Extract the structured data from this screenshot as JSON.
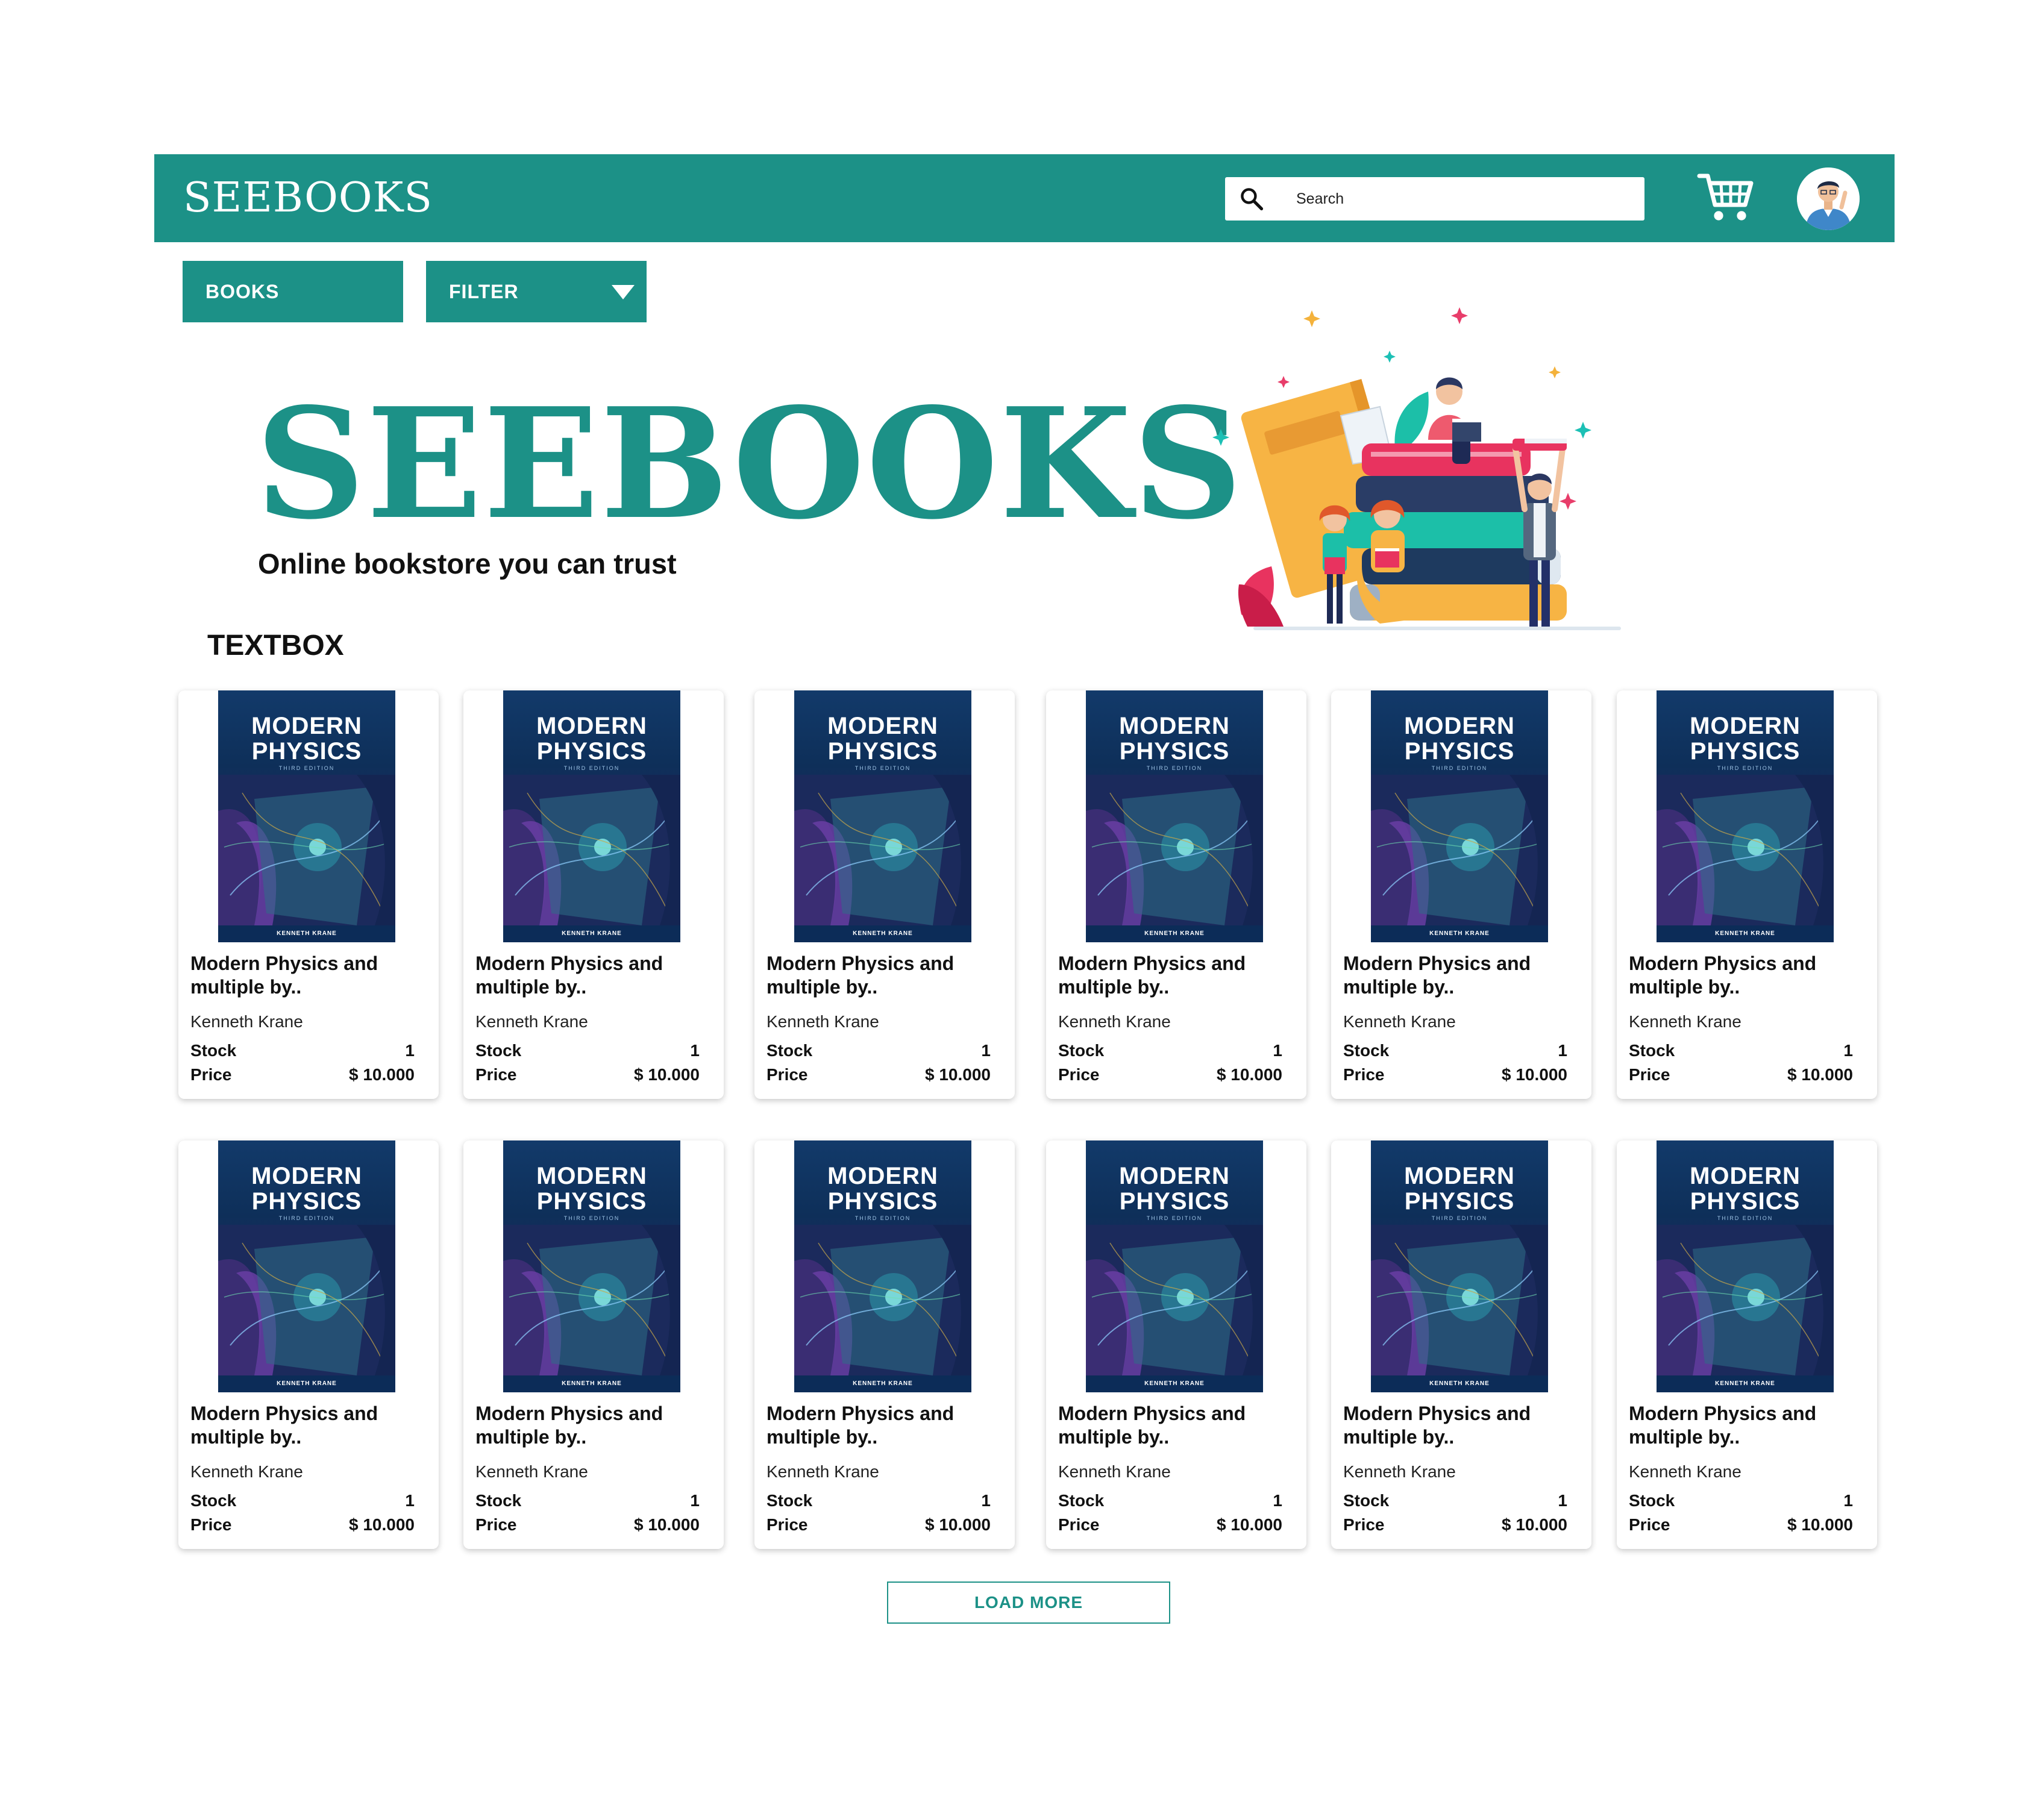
{
  "header": {
    "logo": "SEEBOOKS",
    "search_placeholder": "Search",
    "icons": [
      "search-icon",
      "cart-icon",
      "avatar"
    ]
  },
  "toolbar": {
    "books_label": "BOOKS",
    "filter_label": "FILTER"
  },
  "hero": {
    "title": "SEEBOOKS",
    "subtitle": "Online bookstore you can trust"
  },
  "section_label": "TEXTBOX",
  "book_cover": {
    "title_line1": "MODERN",
    "title_line2": "PHYSICS",
    "edition": "THIRD EDITION",
    "author": "KENNETH KRANE"
  },
  "books": [
    {
      "title": "Modern Physics and multiple by..",
      "author": "Kenneth Krane",
      "stock_label": "Stock",
      "stock": "1",
      "price_label": "Price",
      "price": "$ 10.000"
    },
    {
      "title": "Modern Physics and multiple by..",
      "author": "Kenneth Krane",
      "stock_label": "Stock",
      "stock": "1",
      "price_label": "Price",
      "price": "$ 10.000"
    },
    {
      "title": "Modern Physics and multiple by..",
      "author": "Kenneth Krane",
      "stock_label": "Stock",
      "stock": "1",
      "price_label": "Price",
      "price": "$ 10.000"
    },
    {
      "title": "Modern Physics and multiple by..",
      "author": "Kenneth Krane",
      "stock_label": "Stock",
      "stock": "1",
      "price_label": "Price",
      "price": "$ 10.000"
    },
    {
      "title": "Modern Physics and multiple by..",
      "author": "Kenneth Krane",
      "stock_label": "Stock",
      "stock": "1",
      "price_label": "Price",
      "price": "$ 10.000"
    },
    {
      "title": "Modern Physics and multiple by..",
      "author": "Kenneth Krane",
      "stock_label": "Stock",
      "stock": "1",
      "price_label": "Price",
      "price": "$ 10.000"
    },
    {
      "title": "Modern Physics and multiple by..",
      "author": "Kenneth Krane",
      "stock_label": "Stock",
      "stock": "1",
      "price_label": "Price",
      "price": "$ 10.000"
    },
    {
      "title": "Modern Physics and multiple by..",
      "author": "Kenneth Krane",
      "stock_label": "Stock",
      "stock": "1",
      "price_label": "Price",
      "price": "$ 10.000"
    },
    {
      "title": "Modern Physics and multiple by..",
      "author": "Kenneth Krane",
      "stock_label": "Stock",
      "stock": "1",
      "price_label": "Price",
      "price": "$ 10.000"
    },
    {
      "title": "Modern Physics and multiple by..",
      "author": "Kenneth Krane",
      "stock_label": "Stock",
      "stock": "1",
      "price_label": "Price",
      "price": "$ 10.000"
    },
    {
      "title": "Modern Physics and multiple by..",
      "author": "Kenneth Krane",
      "stock_label": "Stock",
      "stock": "1",
      "price_label": "Price",
      "price": "$ 10.000"
    },
    {
      "title": "Modern Physics and multiple by..",
      "author": "Kenneth Krane",
      "stock_label": "Stock",
      "stock": "1",
      "price_label": "Price",
      "price": "$ 10.000"
    }
  ],
  "load_more_label": "LOAD MORE",
  "colors": {
    "brand": "#1c9187",
    "cover_dark": "#0e2f59"
  }
}
